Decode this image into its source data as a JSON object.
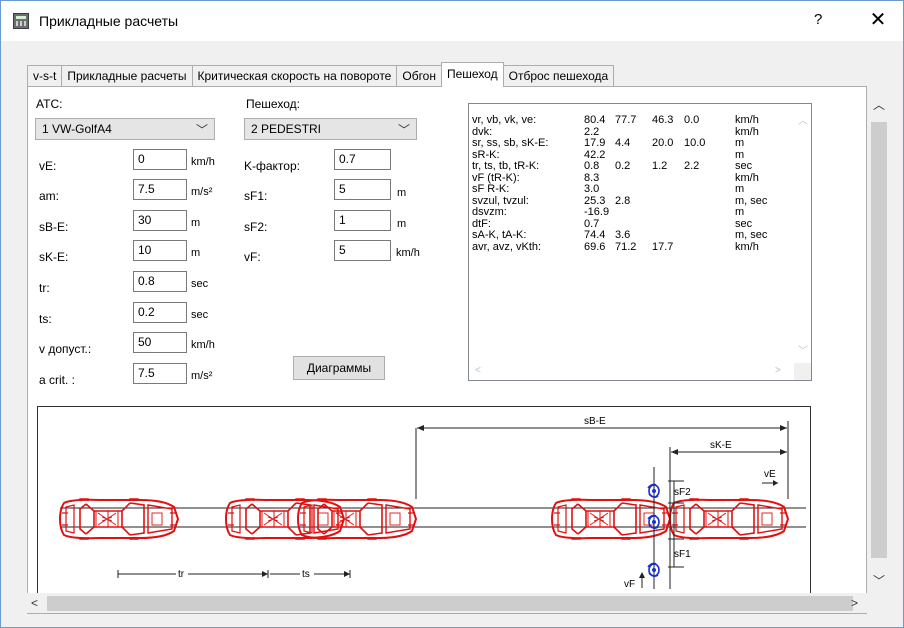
{
  "window": {
    "title": "Прикладные расчеты",
    "help_label": "?",
    "close_label": "✕"
  },
  "tabs": [
    {
      "label": "v-s-t"
    },
    {
      "label": "Прикладные расчеты"
    },
    {
      "label": "Критическая скорость на повороте"
    },
    {
      "label": "Обгон"
    },
    {
      "label": "Пешеход",
      "active": true
    },
    {
      "label": "Отброс пешехода"
    }
  ],
  "vehicle": {
    "header": "ATC:",
    "selected": "1  VW-GolfA4",
    "fields": [
      {
        "label": "vE:",
        "value": "0",
        "unit": "km/h"
      },
      {
        "label": "am:",
        "value": "7.5",
        "unit": "m/s²"
      },
      {
        "label": "sB-E:",
        "value": "30",
        "unit": "m"
      },
      {
        "label": "sK-E:",
        "value": "10",
        "unit": "m"
      },
      {
        "label": "tr:",
        "value": "0.8",
        "unit": "sec"
      },
      {
        "label": "ts:",
        "value": "0.2",
        "unit": "sec"
      },
      {
        "label": "v допуст.:",
        "value": "50",
        "unit": "km/h"
      },
      {
        "label": "a crit. :",
        "value": "7.5",
        "unit": "m/s²"
      }
    ]
  },
  "pedestrian": {
    "header": "Пешеход:",
    "selected": "2  PEDESTRI",
    "fields": [
      {
        "label": "K-фактор:",
        "value": "0.7",
        "unit": ""
      },
      {
        "label": "sF1:",
        "value": "5",
        "unit": "m"
      },
      {
        "label": "sF2:",
        "value": "1",
        "unit": "m"
      },
      {
        "label": "vF:",
        "value": "5",
        "unit": "km/h"
      }
    ]
  },
  "diagrams_button": "Диаграммы",
  "results": [
    {
      "label": "vr, vb, vk, ve:",
      "v1": "80.4",
      "v2": "77.7",
      "v3": "46.3",
      "v4": "0.0",
      "unit": "km/h"
    },
    {
      "label": "dvk:",
      "v1": "2.2",
      "v2": "",
      "v3": "",
      "v4": "",
      "unit": "km/h"
    },
    {
      "label": "sr, ss, sb, sK-E:",
      "v1": "17.9",
      "v2": "4.4",
      "v3": "20.0",
      "v4": "10.0",
      "unit": "m"
    },
    {
      "label": "sR-K:",
      "v1": "42.2",
      "v2": "",
      "v3": "",
      "v4": "",
      "unit": "m"
    },
    {
      "label": "tr, ts, tb, tR-K:",
      "v1": "0.8",
      "v2": "0.2",
      "v3": "1.2",
      "v4": "2.2",
      "unit": "sec"
    },
    {
      "label": "vF (tR-K):",
      "v1": "8.3",
      "v2": "",
      "v3": "",
      "v4": "",
      "unit": "km/h"
    },
    {
      "label": "sF R-K:",
      "v1": "3.0",
      "v2": "",
      "v3": "",
      "v4": "",
      "unit": "m"
    },
    {
      "label": "svzul, tvzul:",
      "v1": "25.3",
      "v2": "2.8",
      "v3": "",
      "v4": "",
      "unit": "m, sec"
    },
    {
      "label": "dsvzm:",
      "v1": "-16.9",
      "v2": "",
      "v3": "",
      "v4": "",
      "unit": "m"
    },
    {
      "label": "dtF:",
      "v1": "0.7",
      "v2": "",
      "v3": "",
      "v4": "",
      "unit": "sec"
    },
    {
      "label": "sA-K, tA-K:",
      "v1": "74.4",
      "v2": "3.6",
      "v3": "",
      "v4": "",
      "unit": "m, sec"
    },
    {
      "label": "avr, avz, vKth:",
      "v1": "69.6",
      "v2": "71.2",
      "v3": "17.7",
      "v4": "",
      "unit": "km/h"
    }
  ],
  "diagram": {
    "labels": {
      "sBE": "sB-E",
      "sKE": "sK-E",
      "tr": "tr",
      "ts": "ts",
      "sF1": "sF1",
      "sF2": "sF2",
      "vF": "vF",
      "vE": "vE"
    }
  },
  "colors": {
    "car": "#e01010",
    "pedestrian": "#1a2fd0",
    "accent": "#6b9bd1"
  }
}
